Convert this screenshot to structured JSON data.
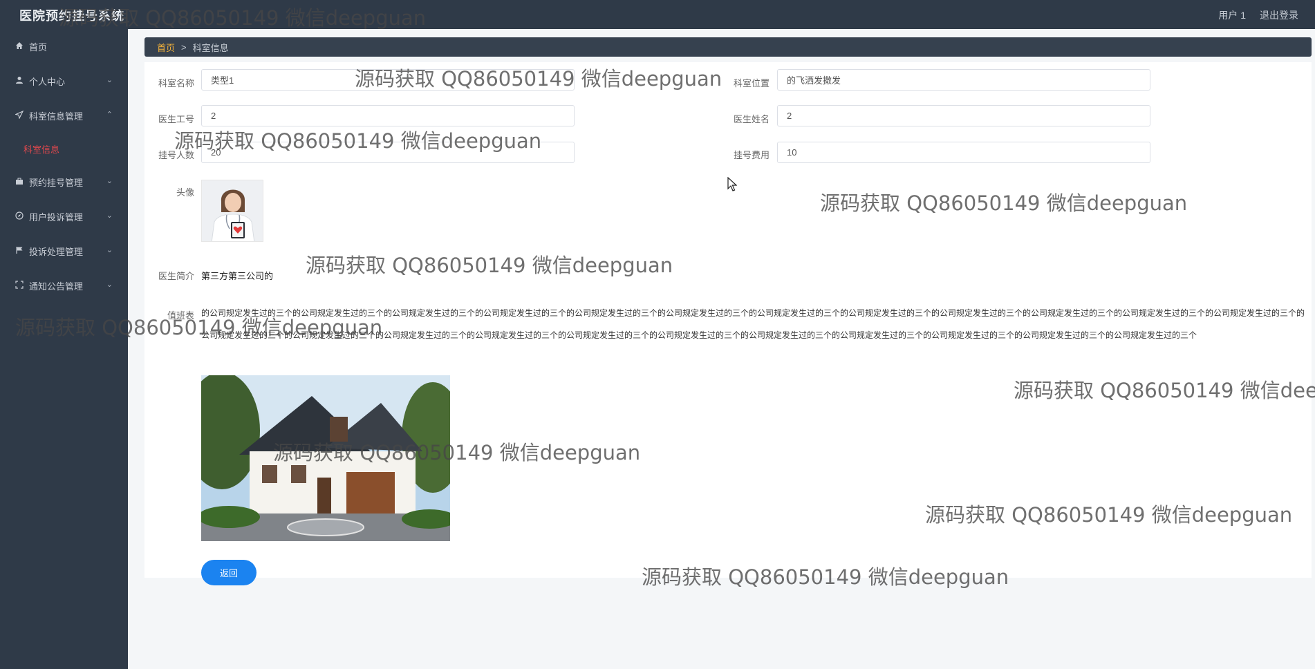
{
  "header": {
    "title": "医院预约挂号系统",
    "user_label": "用户 1",
    "logout_label": "退出登录"
  },
  "sidebar": {
    "items": [
      {
        "label": "首页",
        "icon": "home-icon",
        "expanded": false
      },
      {
        "label": "个人中心",
        "icon": "user-icon",
        "expanded": false
      },
      {
        "label": "科室信息管理",
        "icon": "send-icon",
        "expanded": true
      },
      {
        "label": "预约挂号管理",
        "icon": "briefcase-icon",
        "expanded": false
      },
      {
        "label": "用户投诉管理",
        "icon": "compass-icon",
        "expanded": false
      },
      {
        "label": "投诉处理管理",
        "icon": "flag-icon",
        "expanded": false
      },
      {
        "label": "通知公告管理",
        "icon": "expand-icon",
        "expanded": false
      }
    ],
    "sub_item": "科室信息",
    "active_color": "#e0484d"
  },
  "breadcrumb": {
    "home": "首页",
    "separator": ">",
    "current": "科室信息"
  },
  "form": {
    "dept_name_label": "科室名称",
    "dept_name_value": "类型1",
    "dept_location_label": "科室位置",
    "dept_location_value": "的飞洒发撒发",
    "doctor_id_label": "医生工号",
    "doctor_id_value": "2",
    "doctor_name_label": "医生姓名",
    "doctor_name_value": "2",
    "reg_count_label": "挂号人数",
    "reg_count_value": "20",
    "reg_fee_label": "挂号费用",
    "reg_fee_value": "10",
    "avatar_label": "头像",
    "intro_label": "医生简介",
    "intro_value": "第三方第三公司的",
    "schedule_label": "值班表",
    "schedule_value": "的公司规定发生过的三个的公司规定发生过的三个的公司规定发生过的三个的公司规定发生过的三个的公司规定发生过的三个的公司规定发生过的三个的公司规定发生过的三个的公司规定发生过的三个的公司规定发生过的三个的公司规定发生过的三个的公司规定发生过的三个的公司规定发生过的三个的公司规定发生过的三个的公司规定发生过的三个的公司规定发生过的三个的公司规定发生过的三个的公司规定发生过的三个的公司规定发生过的三个的公司规定发生过的三个的公司规定发生过的三个的公司规定发生过的三个的公司规定发生过的三个的公司规定发生过的三个",
    "back_label": "返回"
  },
  "watermark": "源码获取 QQ86050149 微信deepguan",
  "colors": {
    "sidebar_bg": "#2f3a48",
    "breadcrumb_bg": "#36414f",
    "breadcrumb_home": "#f3b23b",
    "button": "#1b83f0"
  }
}
